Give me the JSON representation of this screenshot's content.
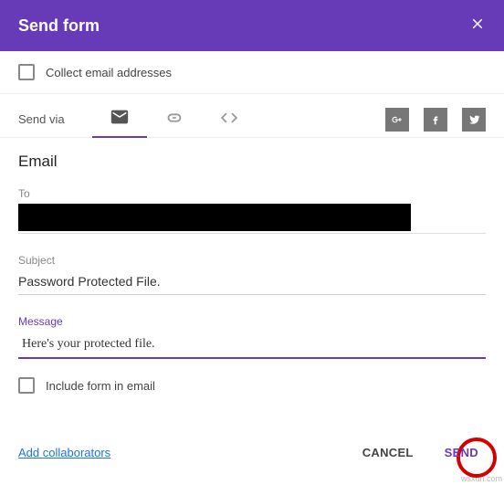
{
  "header": {
    "title": "Send form"
  },
  "collect": {
    "label": "Collect email addresses"
  },
  "sendvia": {
    "label": "Send via"
  },
  "email": {
    "heading": "Email",
    "to_label": "To",
    "subject_label": "Subject",
    "subject_value": "Password Protected File.",
    "message_label": "Message",
    "message_value": "Here's your protected file."
  },
  "include": {
    "label": "Include form in email"
  },
  "footer": {
    "add_collaborators": "Add collaborators",
    "cancel": "CANCEL",
    "send": "SEND"
  },
  "watermark": "wsxdn.com"
}
